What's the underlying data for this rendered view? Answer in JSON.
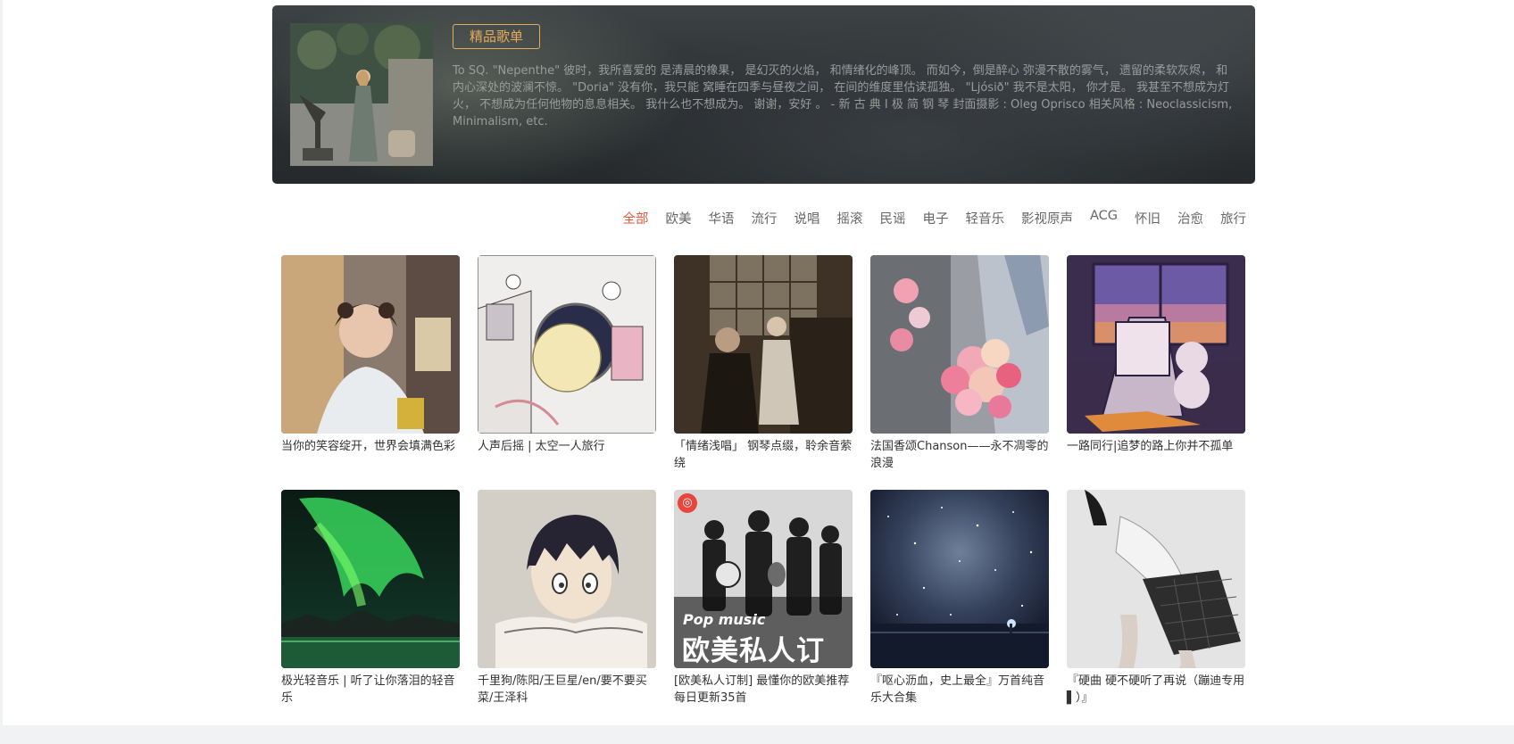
{
  "banner": {
    "badge": "精品歌单",
    "description": "To SQ. \"Nepenthe\" 彼时，我所喜爱的 是清晨的橡果， 是幻灭的火焰， 和情绪化的峰顶。 而如今，倒是醉心 弥漫不散的雾气， 遗留的柔软灰烬， 和内心深处的波澜不惊。 \"Doria\" 没有你，我只能 窝睡在四季与昼夜之间， 在间的维度里估读孤独。 \"Ljósið\" 我不是太阳， 你才是。 我甚至不想成为灯火， 不想成为任何他物的息息相关。 我什么也不想成为。 谢谢，安好 。 - 新 古 典 I 极 简 钢 琴 封面摄影 : Oleg Oprisco 相关风格 : Neoclassicism, Minimalism, etc."
  },
  "categories": [
    "全部",
    "欧美",
    "华语",
    "流行",
    "说唱",
    "摇滚",
    "民谣",
    "电子",
    "轻音乐",
    "影视原声",
    "ACG",
    "怀旧",
    "治愈",
    "旅行"
  ],
  "active_category": "全部",
  "playlists": [
    {
      "title": "当你的笑容绽开，世界会填满色彩"
    },
    {
      "title": "人声后摇 | 太空一人旅行"
    },
    {
      "title": "「情绪浅唱」 钢琴点缀，聆余音萦绕"
    },
    {
      "title": "法国香颂Chanson——永不凋零的浪漫"
    },
    {
      "title": "一路同行|追梦的路上你并不孤单"
    },
    {
      "title": "极光轻音乐 | 听了让你落泪的轻音乐"
    },
    {
      "title": "千里狗/陈阳/王巨星/en/要不要买菜/王泽科"
    },
    {
      "title": "[欧美私人订制] 最懂你的欧美推荐 每日更新35首",
      "cover_label": "Pop music",
      "cover_title": "欧美私人订制"
    },
    {
      "title": "『呕心沥血，史上最全』万首纯音乐大合集"
    },
    {
      "title": "『硬曲 硬不硬听了再说（蹦迪专用▌）』"
    }
  ],
  "colors": {
    "accent": "#e8573e",
    "badge": "#e7aa5a"
  }
}
